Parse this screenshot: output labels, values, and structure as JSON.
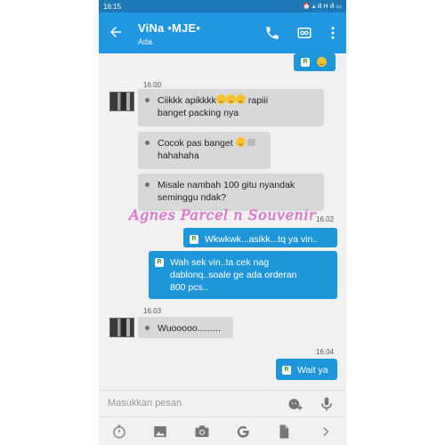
{
  "status_bar": {
    "time": "16:15",
    "icons": "⏰ ▴ ıll H ıll ▭"
  },
  "header": {
    "title": "ViNa •MJE•",
    "subtitle": "Ada"
  },
  "icons": {
    "back": "back-arrow-icon",
    "call": "phone-icon",
    "profile": "contact-card-icon",
    "more": "more-vert-icon",
    "sticker": "add-sticker-icon",
    "mic": "microphone-icon",
    "timer": "timer-icon",
    "gallery": "image-icon",
    "camera": "camera-icon",
    "google": "google-icon",
    "file": "file-icon",
    "expand": "chevron-right-icon"
  },
  "messages": {
    "time1": "16.00",
    "m1_before": "Ciikkk apikkkk",
    "m1_after": " rapiii",
    "m1_line2": "banget packing nya",
    "m2_line1": "Cocok pas banget",
    "m2_line2": "hahahaha",
    "m3_line1": "Misale nambah 100 gitu nyandak",
    "m3_line2": "seminggu ndak?",
    "time2": "16.02",
    "out1": "Wkwkwk...asikk...tq ya vin..",
    "out2_line1": "Wah sek vin..ta cek nag",
    "out2_line2": "dablonq..soale ge ada orderan",
    "out2_line3": "800 pcs..",
    "time3": "16.03",
    "m4": "Wuooooo.........",
    "time4": "16.04",
    "out3": "Wait ya"
  },
  "watermark": "Agnes Parcel n Souvenir",
  "composer": {
    "placeholder": "Masukkan pesan"
  },
  "colors": {
    "appbar": "#2196e3",
    "statusbar": "#1b79b8",
    "outgoing": "#1e96da",
    "incoming": "#d8d8d8",
    "background": "#f1f1f1",
    "watermark": "#e070d0"
  }
}
